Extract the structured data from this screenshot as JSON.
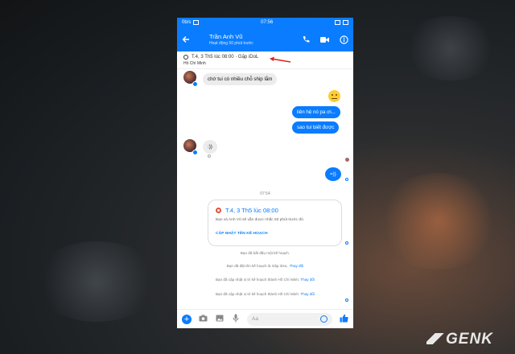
{
  "status_bar": {
    "speed_left": "0b/s",
    "speed_left2": "0b/s",
    "time": "07:56"
  },
  "header": {
    "name": "Trần Anh Vũ",
    "status": "Hoạt động 50 phút trước",
    "icons": [
      "back-arrow-icon",
      "phone-icon",
      "video-icon",
      "info-icon"
    ]
  },
  "pinned_plan": {
    "text": "T.4, 3 Th5 lúc 08:00 · Gặp iDoL",
    "location": "Hồ Chí Minh"
  },
  "messages": [
    {
      "from": "them",
      "text": "chớ tui có nhiều chỗ ship lắm"
    },
    {
      "from": "me",
      "text": "liên hệ nó pa ơi..."
    },
    {
      "from": "me",
      "text": "sao tui biết được"
    },
    {
      "from": "them",
      "text": ":))"
    },
    {
      "from": "me",
      "text": "=))"
    }
  ],
  "time_separator": "07:54",
  "plan_card": {
    "title": "T.4, 3 Th5 lúc 08:00",
    "description": "Bạn và Anh Vũ sẽ vẫn được nhắc 50 phút trước đó.",
    "button": "CẬP NHẬT TÊN KẾ HOẠCH"
  },
  "system_messages": [
    {
      "text": "Bạn đã bắt đầu một kế hoạch.",
      "link": ""
    },
    {
      "text": "Bạn đã đặt tên kế hoạch là Gặp iDoL.",
      "link": "Thay đổi"
    },
    {
      "text": "Bạn đã cập nhật vị trí kế hoạch thành Hồ Chí Minh.",
      "link": "Thay đổi"
    },
    {
      "text": "Bạn đã cập nhật vị trí kế hoạch thành Hồ Chí Minh.",
      "link": "Thay đổi"
    }
  ],
  "composer": {
    "placeholder": "Aa"
  },
  "watermark": "GENK",
  "colors": {
    "accent": "#0a7cff",
    "annotation_arrow": "#e02020"
  }
}
